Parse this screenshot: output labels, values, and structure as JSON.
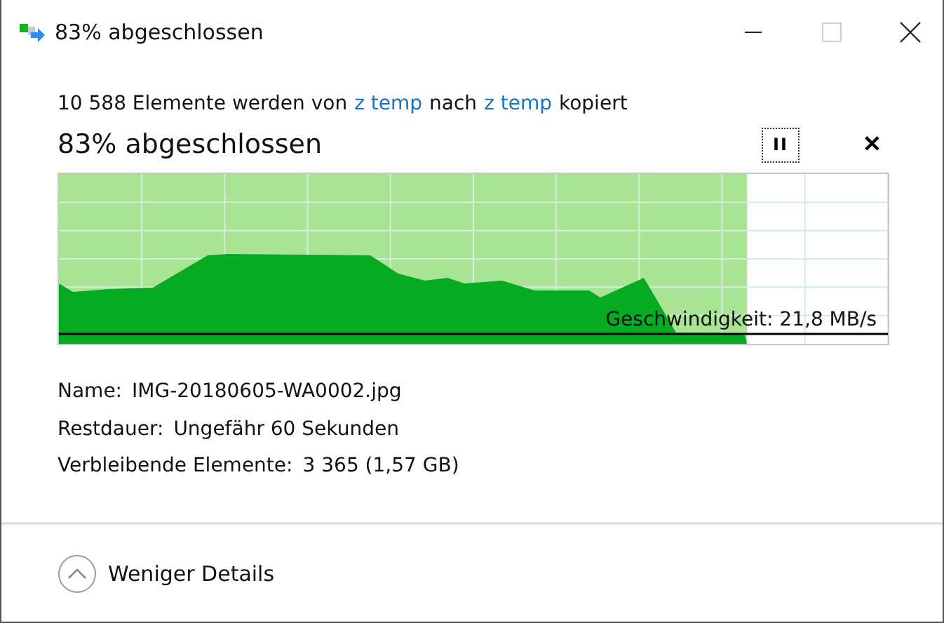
{
  "window": {
    "title": "83% abgeschlossen",
    "maximize_disabled": true
  },
  "summary": [
    {
      "kind": "text",
      "text": "10 588 Elemente werden von"
    },
    {
      "kind": "link",
      "text": "z temp"
    },
    {
      "kind": "text",
      "text": "nach"
    },
    {
      "kind": "link",
      "text": "z temp"
    },
    {
      "kind": "text",
      "text": "kopiert"
    }
  ],
  "heading": "83% abgeschlossen",
  "controls": {
    "pause": "II",
    "cancel": "✕"
  },
  "progress": {
    "level": 0.83,
    "speed": "Geschwindigkeit: 21,8 MB/s"
  },
  "details": [
    {
      "label": "Name:",
      "value": "IMG-20180605-WA0002.jpg"
    },
    {
      "label": "Restdauer:",
      "value": "Ungefähr 60 Sekunden"
    },
    {
      "label": "Verbleibende Elemente:",
      "value": "3 365 (1,57 GB)"
    }
  ],
  "footer": {
    "toggle": "Weniger Details",
    "expanded": true
  }
}
